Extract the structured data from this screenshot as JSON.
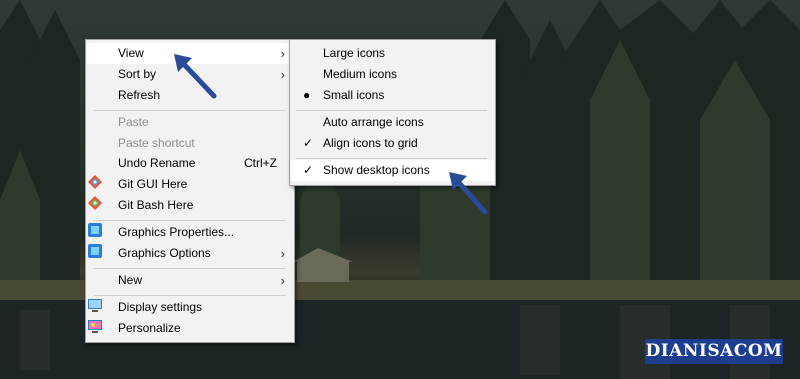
{
  "context_menu": {
    "items": [
      {
        "label": "View"
      },
      {
        "label": "Sort by"
      },
      {
        "label": "Refresh"
      },
      {
        "label": "Paste"
      },
      {
        "label": "Paste shortcut"
      },
      {
        "label": "Undo Rename",
        "shortcut": "Ctrl+Z"
      },
      {
        "label": "Git GUI Here"
      },
      {
        "label": "Git Bash Here"
      },
      {
        "label": "Graphics Properties..."
      },
      {
        "label": "Graphics Options"
      },
      {
        "label": "New"
      },
      {
        "label": "Display settings"
      },
      {
        "label": "Personalize"
      }
    ]
  },
  "view_submenu": {
    "items": [
      {
        "label": "Large icons"
      },
      {
        "label": "Medium icons"
      },
      {
        "label": "Small icons",
        "selected": true
      },
      {
        "label": "Auto arrange icons",
        "checked": false
      },
      {
        "label": "Align icons to grid",
        "checked": true
      },
      {
        "label": "Show desktop icons",
        "checked": true
      }
    ]
  },
  "watermark": "DIANISACOM",
  "colors": {
    "menu_bg": "#f2f2f2",
    "highlight": "#ffffff",
    "arrow": "#2a4a9a",
    "watermark_bg": "#1e3d8f"
  }
}
